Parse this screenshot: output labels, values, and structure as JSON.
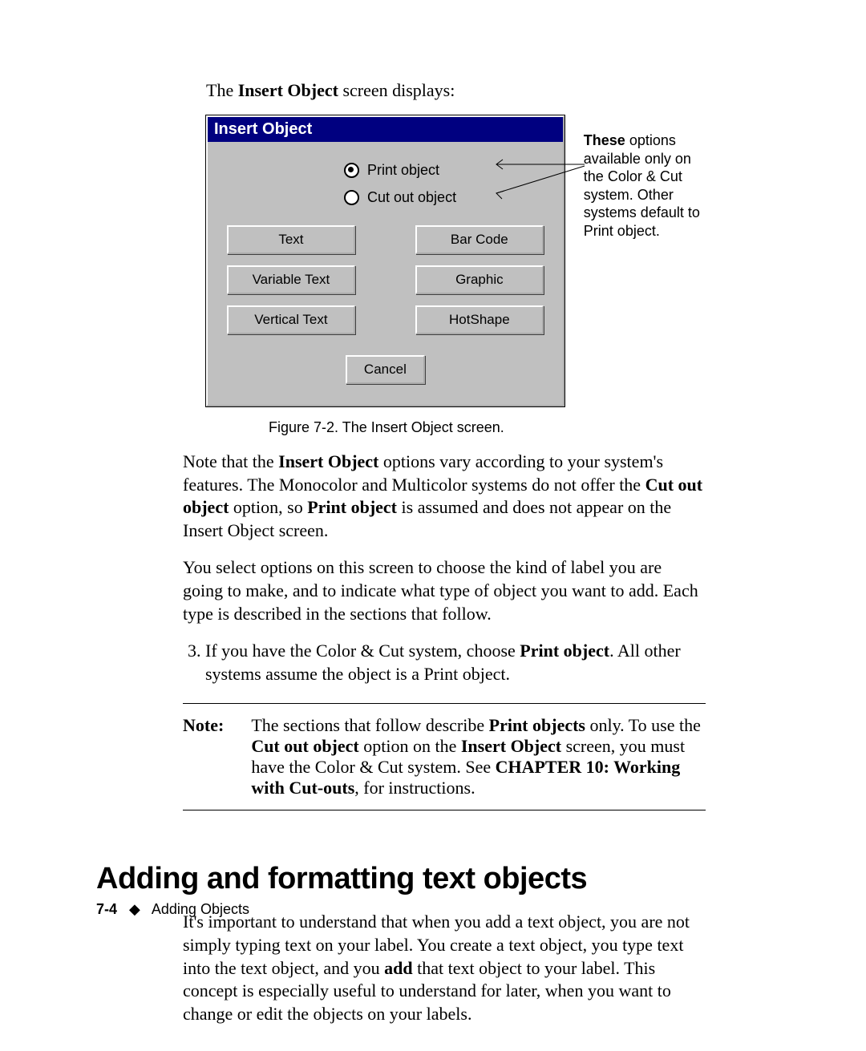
{
  "intro": {
    "pre": "The ",
    "bold": "Insert Object",
    "post": " screen displays:"
  },
  "dialog": {
    "title": "Insert Object",
    "radios": {
      "print": "Print object",
      "cutout": "Cut out object"
    },
    "buttons": {
      "text": "Text",
      "barcode": "Bar Code",
      "vartext": "Variable Text",
      "graphic": "Graphic",
      "verttext": "Vertical Text",
      "hotshape": "HotShape"
    },
    "cancel": "Cancel"
  },
  "sidenote": {
    "bold": "These",
    "rest": " options available only on the Color & Cut system. Other systems default to Print object."
  },
  "caption": "Figure 7-2. The Insert Object screen.",
  "para1": {
    "a": "Note that the ",
    "b1": "Insert Object",
    "c": " options vary according to your system's features. The Monocolor and Multicolor systems do not offer the ",
    "b2": "Cut out object",
    "d": " option, so ",
    "b3": "Print object",
    "e": " is assumed and does not appear on the Insert Object screen."
  },
  "para2": "You select options on this screen to choose the kind of label you are going to make, and to indicate what type of object you want to add. Each type is described in the sections that follow.",
  "listitem3": {
    "a": "If you have the Color & Cut system, choose ",
    "b": "Print object",
    "c": ". All other systems assume the object is a Print object."
  },
  "note": {
    "label": "Note:",
    "a": "The sections that follow describe ",
    "b1": "Print objects",
    "c": " only. To use the ",
    "b2": "Cut out object",
    "d": " option on the ",
    "b3": "Insert Object",
    "e": " screen, you must have the Color & Cut system. See ",
    "b4": "CHAPTER 10: Working with Cut-outs",
    "f": ", for instructions."
  },
  "heading": "Adding and formatting text objects",
  "para3": {
    "a": "It's important to understand that when you add a text object, you are not simply typing text on your label. You create a text object, you type text into the text object, and you ",
    "b": "add",
    "c": " that text object to your label. This concept is especially useful to understand for later, when you want to change or edit the objects on your labels."
  },
  "footer": {
    "pagenum": "7-4",
    "diamond": "◆",
    "section": "Adding Objects"
  }
}
